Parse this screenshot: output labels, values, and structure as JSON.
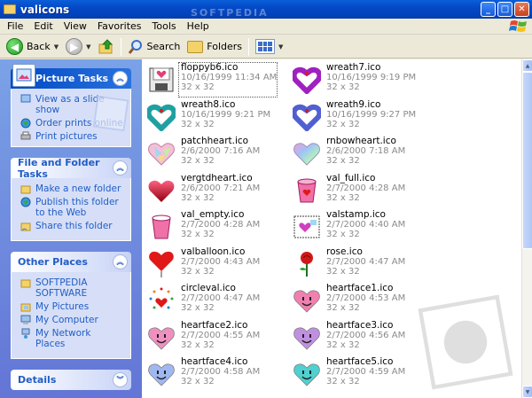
{
  "window": {
    "title": "valicons"
  },
  "menu": [
    "File",
    "Edit",
    "View",
    "Favorites",
    "Tools",
    "Help"
  ],
  "toolbar": {
    "back": "Back",
    "search": "Search",
    "folders": "Folders"
  },
  "watermark": "SOFTPEDIA",
  "panels": {
    "picture_tasks": {
      "title": "Picture Tasks",
      "items": [
        "View as a slide show",
        "Order prints online",
        "Print pictures"
      ]
    },
    "file_tasks": {
      "title": "File and Folder Tasks",
      "items": [
        "Make a new folder",
        "Publish this folder to the Web",
        "Share this folder"
      ]
    },
    "other_places": {
      "title": "Other Places",
      "items": [
        "SOFTPEDIA SOFTWARE",
        "My Pictures",
        "My Computer",
        "My Network Places"
      ]
    },
    "details": {
      "title": "Details"
    }
  },
  "files": [
    {
      "name": "floppyb6.ico",
      "date": "10/16/1999 11:34 AM",
      "size": "32 x 32",
      "icon": "floppy-heart-icon",
      "color": "#e0407a"
    },
    {
      "name": "wreath7.ico",
      "date": "10/16/1999 9:19 PM",
      "size": "32 x 32",
      "icon": "wreath-heart-icon",
      "color": "#a020c0"
    },
    {
      "name": "wreath8.ico",
      "date": "10/16/1999 9:21 PM",
      "size": "32 x 32",
      "icon": "wreath-heart-icon",
      "color": "#20a0a0"
    },
    {
      "name": "wreath9.ico",
      "date": "10/16/1999 9:27 PM",
      "size": "32 x 32",
      "icon": "wreath-heart-icon",
      "color": "#5060d0"
    },
    {
      "name": "patchheart.ico",
      "date": "2/6/2000 7:16 AM",
      "size": "32 x 32",
      "icon": "patch-heart-icon",
      "color": "#e8a0c0"
    },
    {
      "name": "rnbowheart.ico",
      "date": "2/6/2000 7:18 AM",
      "size": "32 x 32",
      "icon": "rainbow-heart-icon",
      "color": "#c0a0f0"
    },
    {
      "name": "vergtdheart.ico",
      "date": "2/6/2000 7:21 AM",
      "size": "32 x 32",
      "icon": "gradient-heart-icon",
      "color": "#e01030"
    },
    {
      "name": "val_full.ico",
      "date": "2/7/2000 4:28 AM",
      "size": "32 x 32",
      "icon": "cup-full-icon",
      "color": "#f070a8"
    },
    {
      "name": "val_empty.ico",
      "date": "2/7/2000 4:28 AM",
      "size": "32 x 32",
      "icon": "cup-empty-icon",
      "color": "#f070a8"
    },
    {
      "name": "valstamp.ico",
      "date": "2/7/2000 4:40 AM",
      "size": "32 x 32",
      "icon": "stamp-icon",
      "color": "#d040c0"
    },
    {
      "name": "valballoon.ico",
      "date": "2/7/2000 4:43 AM",
      "size": "32 x 32",
      "icon": "balloon-heart-icon",
      "color": "#e01818"
    },
    {
      "name": "rose.ico",
      "date": "2/7/2000 4:47 AM",
      "size": "32 x 32",
      "icon": "rose-icon",
      "color": "#d01818"
    },
    {
      "name": "circleval.ico",
      "date": "2/7/2000 4:47 AM",
      "size": "32 x 32",
      "icon": "circle-heart-icon",
      "color": "#e01818"
    },
    {
      "name": "heartface1.ico",
      "date": "2/7/2000 4:53 AM",
      "size": "32 x 32",
      "icon": "heart-face-icon",
      "color": "#f080b0"
    },
    {
      "name": "heartface2.ico",
      "date": "2/7/2000 4:55 AM",
      "size": "32 x 32",
      "icon": "heart-face-icon",
      "color": "#f090c0"
    },
    {
      "name": "heartface3.ico",
      "date": "2/7/2000 4:56 AM",
      "size": "32 x 32",
      "icon": "heart-face-icon",
      "color": "#c090e0"
    },
    {
      "name": "heartface4.ico",
      "date": "2/7/2000 4:58 AM",
      "size": "32 x 32",
      "icon": "heart-face-icon",
      "color": "#a0b8f0"
    },
    {
      "name": "heartface5.ico",
      "date": "2/7/2000 4:59 AM",
      "size": "32 x 32",
      "icon": "heart-face-icon",
      "color": "#50d0d0"
    }
  ]
}
